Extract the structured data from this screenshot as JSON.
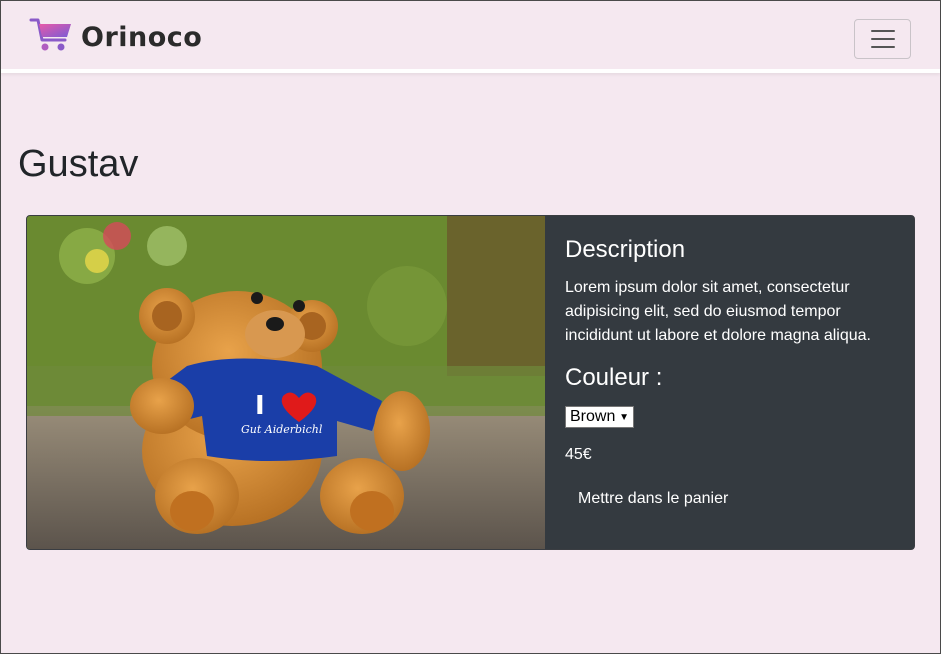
{
  "brand": {
    "name": "Orinoco",
    "logo_icon": "shopping-cart-icon"
  },
  "nav": {
    "toggler_icon": "hamburger-icon"
  },
  "product": {
    "name": "Gustav",
    "image_alt": "teddy bear photo",
    "shirt_text_1": "I",
    "shirt_text_2": "Gut Aiderbichl",
    "description_title": "Description",
    "description": "Lorem ipsum dolor sit amet, consectetur adipisicing elit, sed do eiusmod tempor incididunt ut labore et dolore magna aliqua.",
    "color_label": "Couleur :",
    "selected_color": "Brown",
    "price": "45€",
    "add_to_cart_label": "Mettre dans le panier"
  },
  "colors": {
    "page_bg": "#f5e8f0",
    "card_bg": "#343a40",
    "logo_gradient_start": "#e85aa8",
    "logo_gradient_end": "#7a5bd6"
  }
}
